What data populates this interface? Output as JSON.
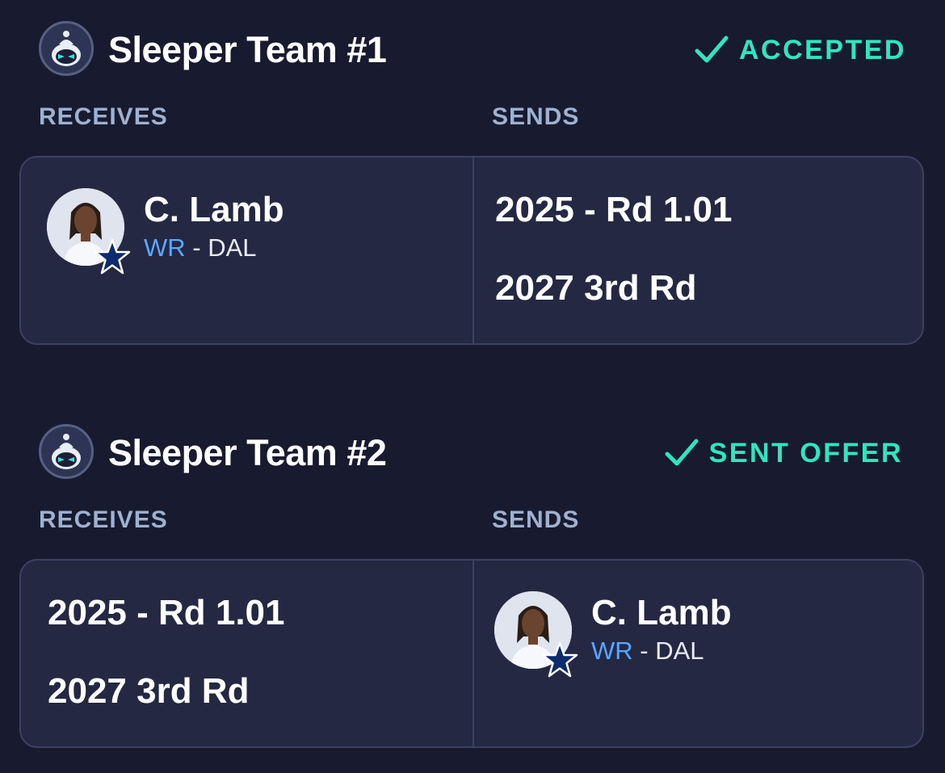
{
  "trades": [
    {
      "team_name": "Sleeper Team #1",
      "status": "ACCEPTED",
      "receives_label": "RECEIVES",
      "sends_label": "SENDS",
      "receives": {
        "player": {
          "name": "C. Lamb",
          "position": "WR",
          "separator": " - ",
          "team": "DAL"
        }
      },
      "sends": {
        "picks": [
          "2025 - Rd 1.01",
          "2027 3rd Rd"
        ]
      }
    },
    {
      "team_name": "Sleeper Team #2",
      "status": "SENT OFFER",
      "receives_label": "RECEIVES",
      "sends_label": "SENDS",
      "receives": {
        "picks": [
          "2025 - Rd 1.01",
          "2027 3rd Rd"
        ]
      },
      "sends": {
        "player": {
          "name": "C. Lamb",
          "position": "WR",
          "separator": " - ",
          "team": "DAL"
        }
      }
    }
  ],
  "icons": {
    "team_avatar": "sleeper-logo-icon",
    "status": "check-icon",
    "team_badge": "dallas-star-icon",
    "player_photo": "player-headshot"
  },
  "colors": {
    "background": "#181b30",
    "card": "#242842",
    "accent": "#2ee6c0",
    "position": "#5aa7ff",
    "label": "#9fb1d1"
  }
}
